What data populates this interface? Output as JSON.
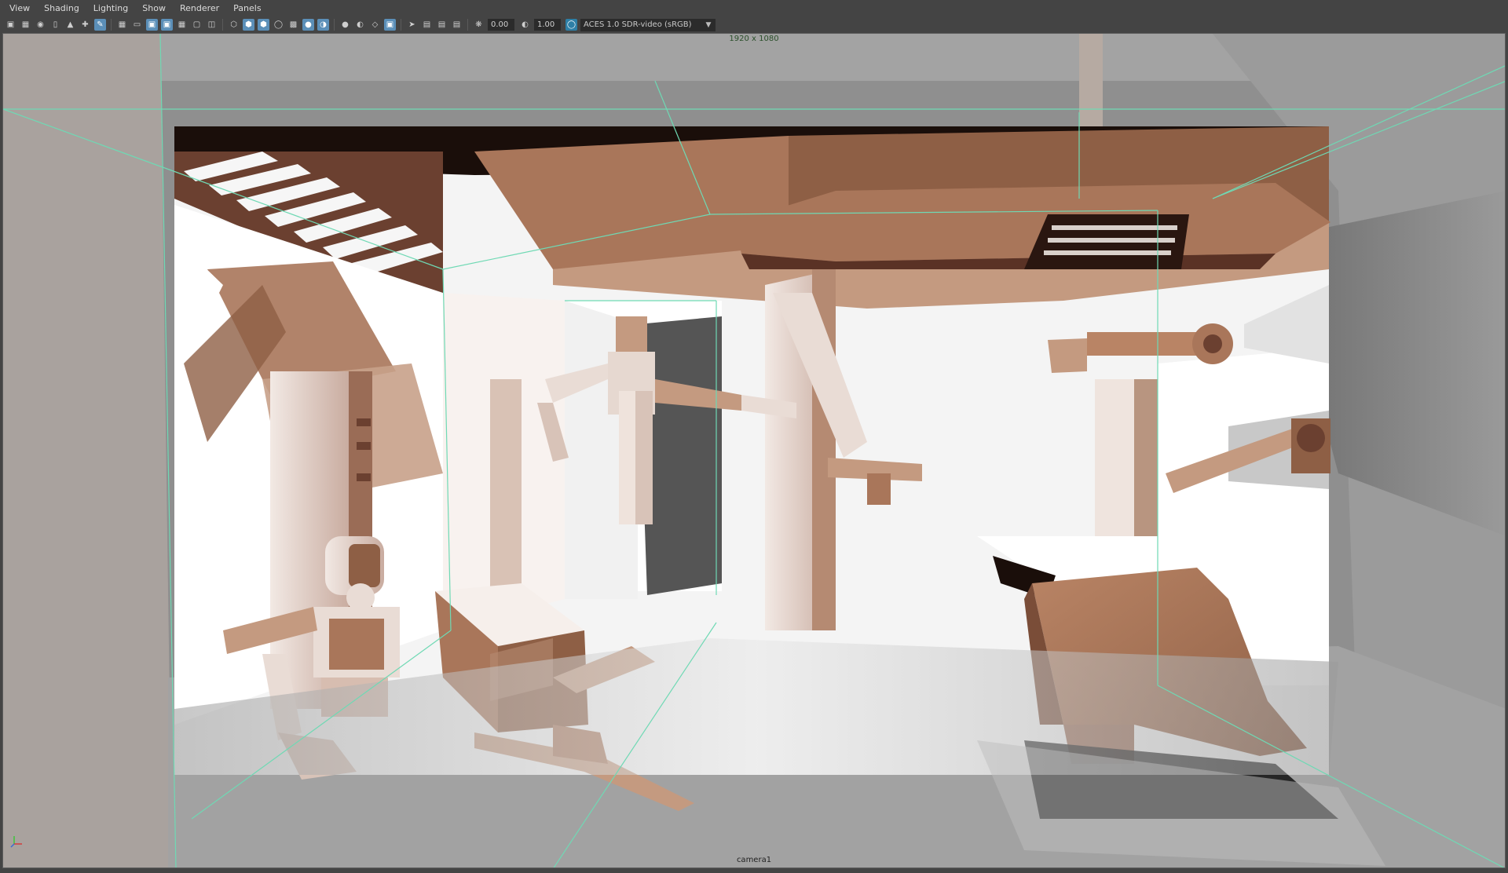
{
  "menu": [
    "View",
    "Shading",
    "Lighting",
    "Show",
    "Renderer",
    "Panels"
  ],
  "toolbar": {
    "exposure_value": "0.00",
    "gamma_value": "1.00",
    "color_space": "ACES 1.0 SDR-video (sRGB)"
  },
  "viewport": {
    "resolution_gate": "1920 x 1080",
    "camera_name": "camera1"
  },
  "colors": {
    "ui_background": "#444444",
    "active_button": "#5b8fb8",
    "gate_lines": "#6fd9b4",
    "terracotta": "#a9765a",
    "shadow": "#1a0e0a"
  },
  "icons": [
    "camera-icon",
    "camera-select-icon",
    "camera-lock-icon",
    "bookmark-icon",
    "image-plane-icon",
    "tumble-icon",
    "pencil-icon",
    "grid-icon",
    "film-gate-icon",
    "resolution-gate-icon",
    "gate-mask-icon",
    "field-chart-icon",
    "safe-action-icon",
    "safe-title-icon",
    "wireframe-icon",
    "smooth-shade-icon",
    "textured-icon",
    "lights-icon",
    "shadows-icon",
    "ambient-occlusion-icon",
    "motion-blur-icon",
    "isolate-icon",
    "xray-icon",
    "xray-joints-icon",
    "xray-components-icon",
    "select-icon",
    "camera-attributes-icon",
    "film-back-icon",
    "snapshot-icon",
    "exposure-icon",
    "gamma-icon",
    "color-management-icon"
  ]
}
